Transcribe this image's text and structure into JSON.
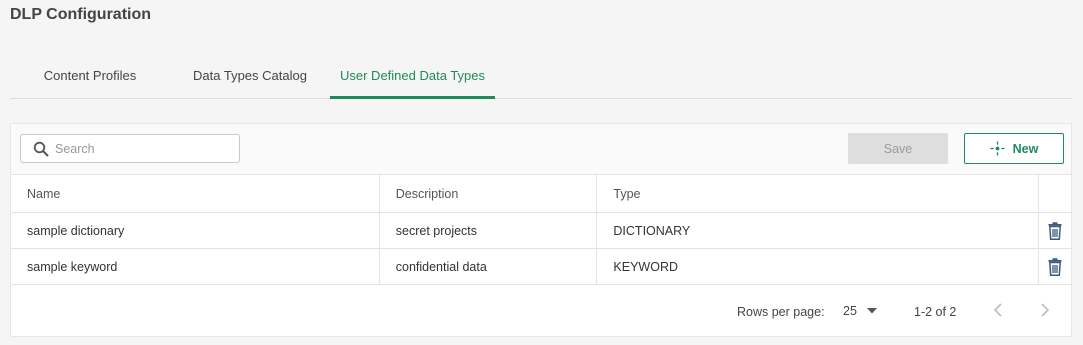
{
  "page": {
    "title": "DLP Configuration"
  },
  "tabs": [
    {
      "label": "Content Profiles",
      "active": false
    },
    {
      "label": "Data Types Catalog",
      "active": false
    },
    {
      "label": "User Defined Data Types",
      "active": true
    }
  ],
  "toolbar": {
    "search_placeholder": "Search",
    "search_value": "",
    "save_label": "Save",
    "new_label": "New"
  },
  "table": {
    "headers": [
      "Name",
      "Description",
      "Type"
    ],
    "rows": [
      {
        "name": "sample dictionary",
        "description": "secret projects",
        "type": "DICTIONARY"
      },
      {
        "name": "sample keyword",
        "description": "confidential data",
        "type": "KEYWORD"
      }
    ]
  },
  "pagination": {
    "rows_per_page_label": "Rows per page:",
    "rows_per_page_value": "25",
    "range_text": "1-2 of 2"
  },
  "colors": {
    "accent": "#1f8a5b",
    "disabled_bg": "#dedede",
    "icon_blue": "#3d5a80"
  },
  "icons": [
    "search-icon",
    "new-icon",
    "trash-icon",
    "caret-down-icon",
    "chevron-left-icon",
    "chevron-right-icon"
  ]
}
